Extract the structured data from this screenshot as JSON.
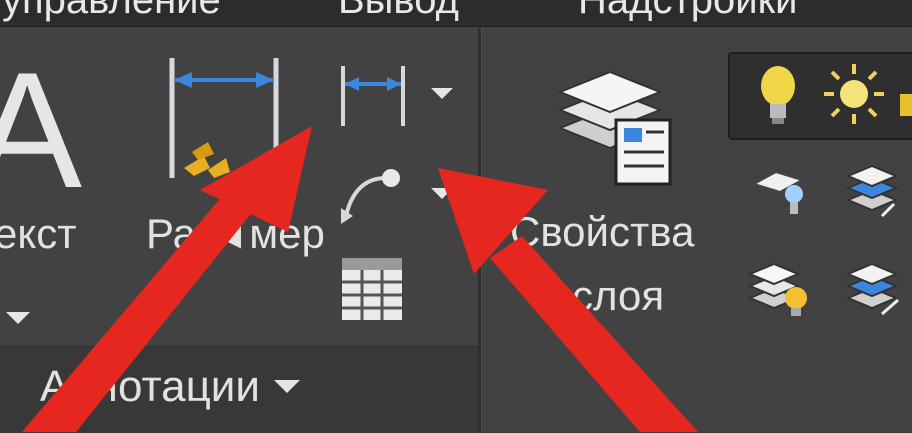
{
  "ribbon_tabs": [
    {
      "label": "управление"
    },
    {
      "label": "Вывод"
    },
    {
      "label": "Надстройки"
    }
  ],
  "annotations_panel": {
    "text_button_label": "екст",
    "text_big_letter": "A",
    "dimension_button_label": "Ра ◄мер",
    "panel_title": "Аннотации"
  },
  "layers_panel": {
    "layer_properties_label_line1": "Свойства",
    "layer_properties_label_line2": "слоя"
  },
  "icons": [
    "linear-dimension-icon",
    "dimension-dropdown-icon",
    "leader-icon",
    "table-icon",
    "layer-properties-icon",
    "bulb-icon",
    "sun-icon",
    "layer-light-icon",
    "layer-stack-icon"
  ],
  "colors": {
    "ribbon_background": "#424242",
    "tab_bar_background": "#2c2c2c",
    "dimension_blue": "#3d86e0",
    "dimension_yellow": "#e8b020",
    "arrow_red": "#e5271f"
  }
}
